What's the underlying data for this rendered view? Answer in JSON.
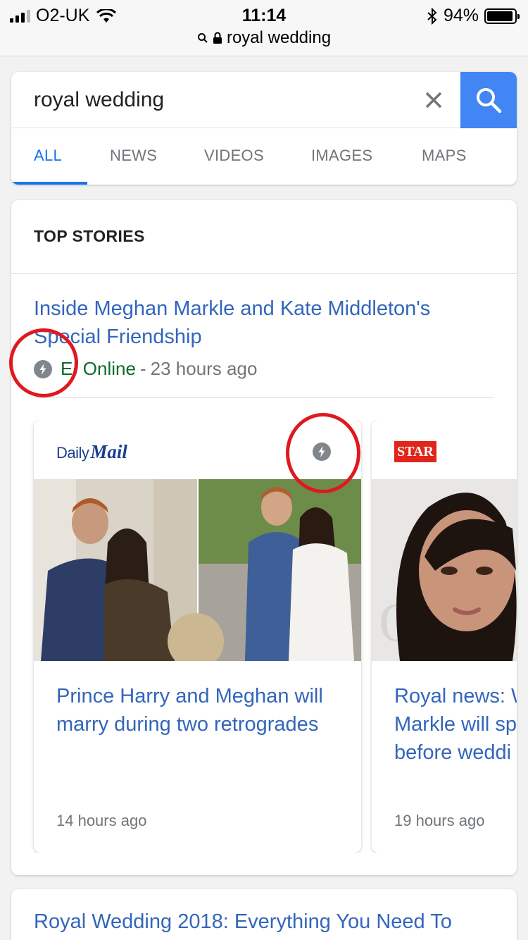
{
  "status_bar": {
    "carrier": "O2-UK",
    "time": "11:14",
    "battery_pct": "94%",
    "battery_level": 0.94,
    "url": "royal wedding"
  },
  "search": {
    "query": "royal wedding",
    "tabs": [
      {
        "label": "ALL",
        "active": true
      },
      {
        "label": "NEWS"
      },
      {
        "label": "VIDEOS"
      },
      {
        "label": "IMAGES"
      },
      {
        "label": "MAPS"
      }
    ],
    "accent_color": "#4285f4"
  },
  "top_stories": {
    "heading": "TOP STORIES",
    "lead": {
      "headline": "Inside Meghan Markle and Kate Middleton's Special Friendship",
      "source": "E! Online",
      "separator": "-",
      "time": "23 hours ago"
    },
    "cards": [
      {
        "publisher": "Daily Mail",
        "publisher_logo_text_1": "Daily",
        "publisher_logo_text_2": "Mail",
        "title": "Prince Harry and Meghan will marry during two retrogrades",
        "time": "14 hours ago",
        "amp": true
      },
      {
        "publisher": "Daily Star",
        "publisher_logo_text": "STAR",
        "title": "Royal news: W Markle will sp before weddi",
        "title_lines": [
          "Royal news: W",
          "Markle will sp",
          "before weddi"
        ],
        "time": "19 hours ago"
      }
    ]
  },
  "next_result": {
    "title": "Royal Wedding 2018: Everything You Need To"
  },
  "annotation_color": "#e0181f"
}
